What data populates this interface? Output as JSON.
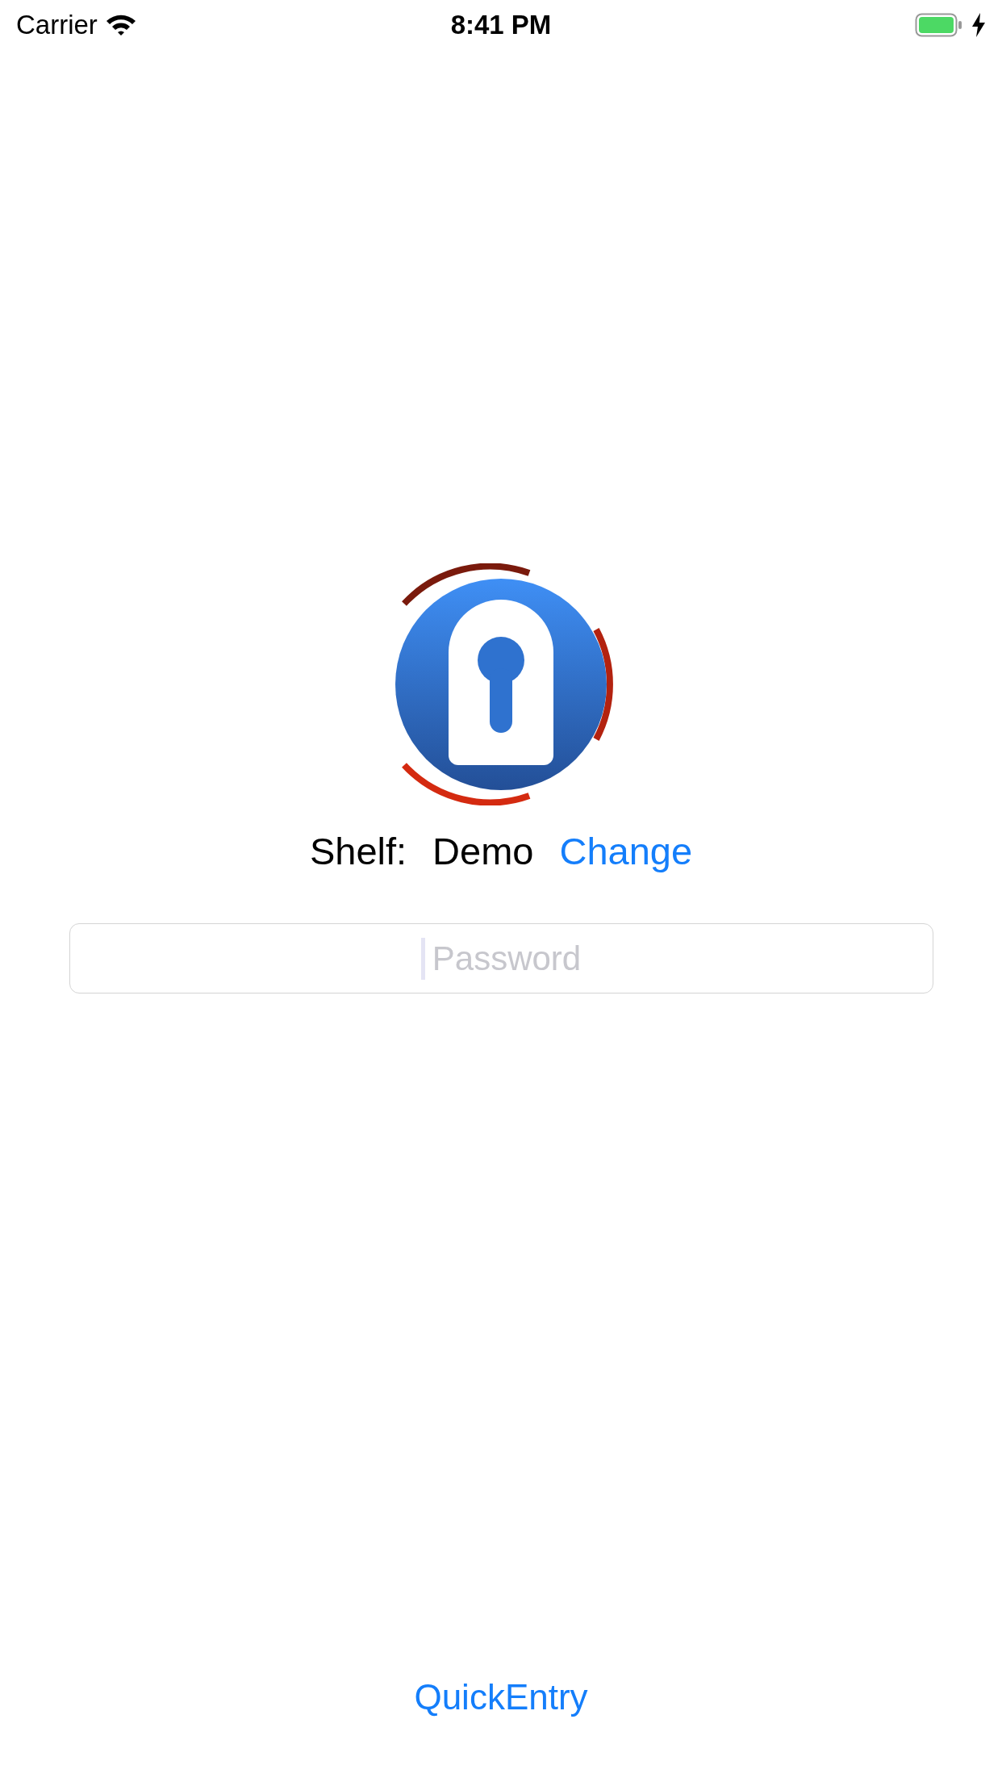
{
  "status_bar": {
    "carrier": "Carrier",
    "time": "8:41 PM"
  },
  "shelf": {
    "label": "Shelf:",
    "name": "Demo",
    "action": "Change"
  },
  "password": {
    "placeholder": "Password",
    "focused": true
  },
  "quick_entry": "QuickEntry"
}
